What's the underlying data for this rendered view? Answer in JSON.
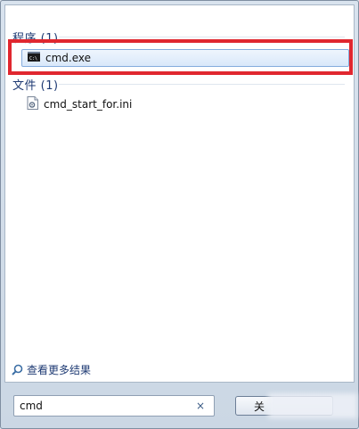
{
  "groups": {
    "programs": {
      "header": "程序 (1)",
      "items": [
        {
          "label": "cmd.exe",
          "icon": "cmd-console-icon"
        }
      ]
    },
    "files": {
      "header": "文件 (1)",
      "items": [
        {
          "label": "cmd_start_for.ini",
          "icon": "ini-file-icon"
        }
      ]
    }
  },
  "more_results": {
    "label": "查看更多结果",
    "icon": "search-icon"
  },
  "search": {
    "value": "cmd",
    "clear_symbol": "×"
  },
  "shutdown": {
    "label": "关"
  },
  "colors": {
    "highlight": "#e0272f",
    "header_text": "#1e3a73",
    "selection_border": "#84acdd"
  }
}
